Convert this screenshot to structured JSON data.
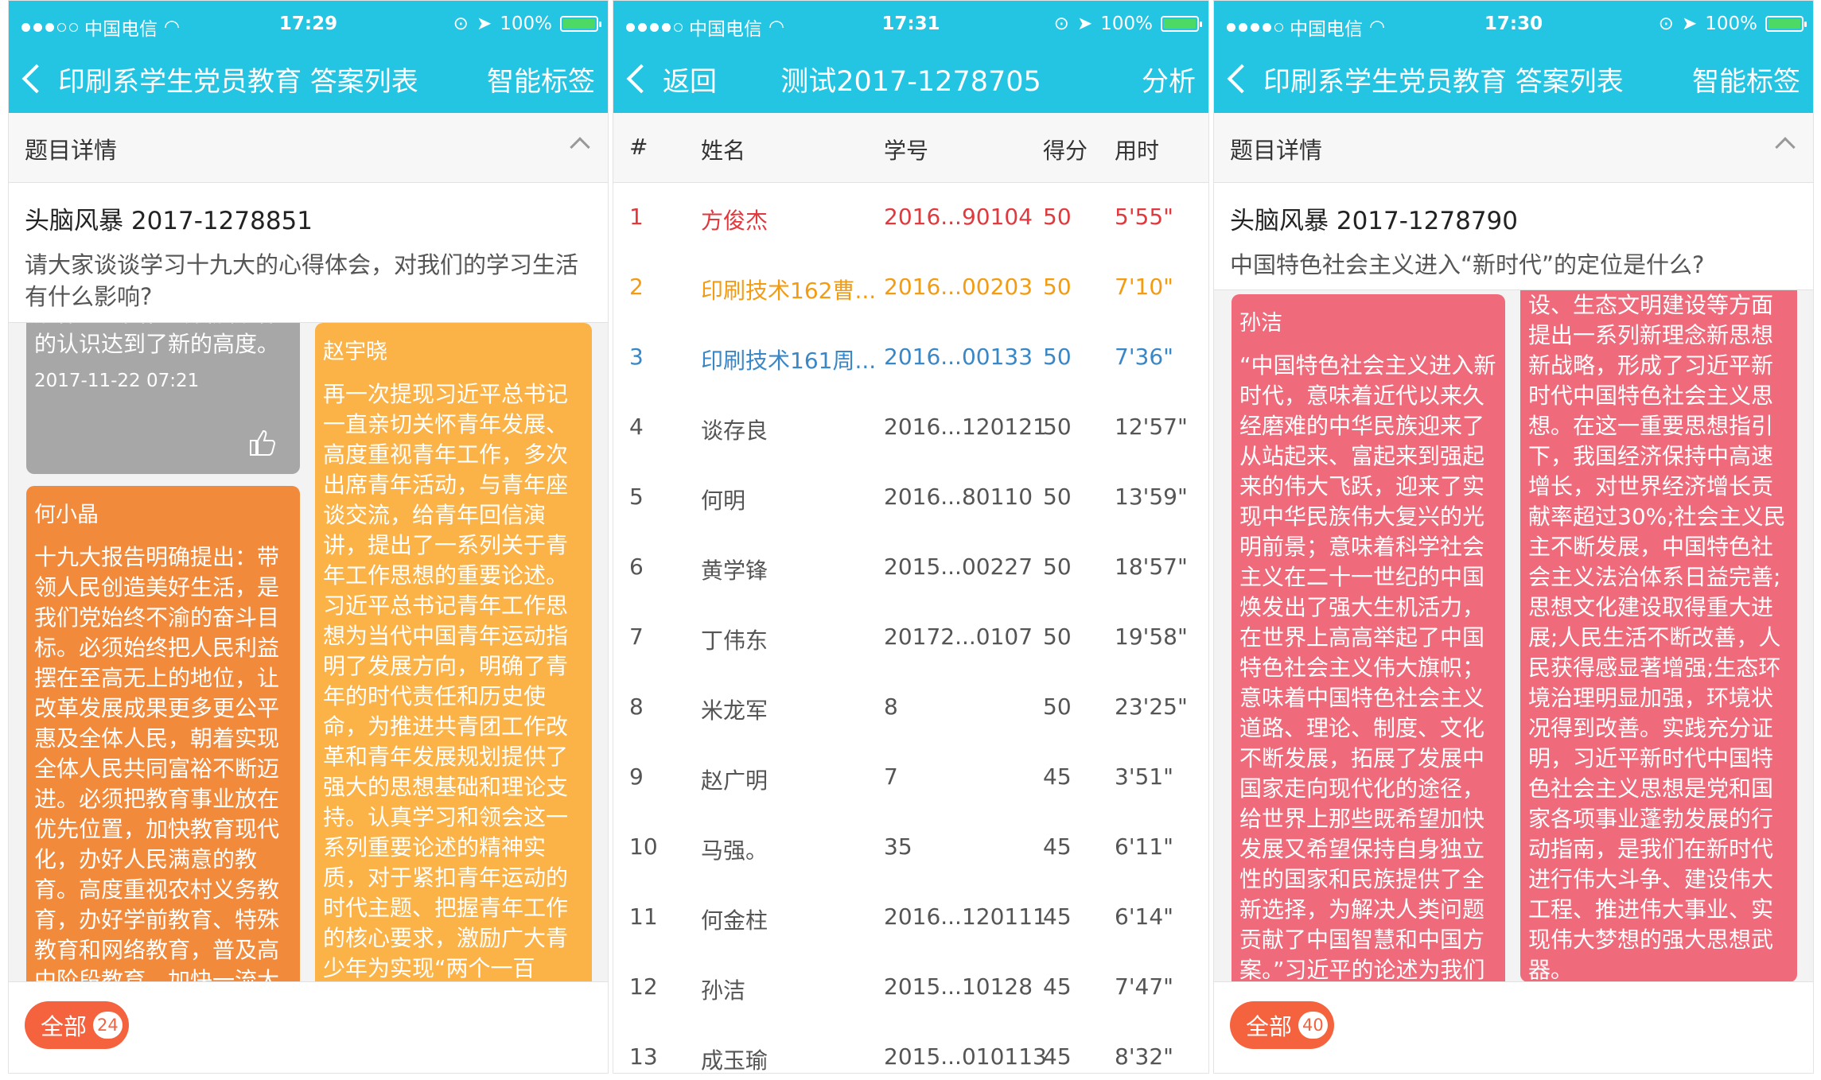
{
  "status": {
    "carrier": "中国电信",
    "battery": "100%"
  },
  "screen1": {
    "time": "17:29",
    "back_label": "印刷系学生党员教育 答案列表",
    "right_action": "智能标签",
    "section_label": "题目详情",
    "question_title": "头脑风暴 2017-1278851",
    "question_text": "请大家谈谈学习十九大的心得体会，对我们的学习生活有什么影响?",
    "cards": [
      {
        "text": "规律、人类社会发展规律的认识达到了新的高度。",
        "date": "2017-11-22 07:21"
      },
      {
        "name": "何小晶",
        "text": "十九大报告明确提出：带领人民创造美好生活，是我们党始终不渝的奋斗目标。必须始终把人民利益摆在至高无上的地位，让改革发展成果更多更公平惠及全体人民，朝着实现全体人民共同富裕不断迈进。必须把教育事业放在优先位置，加快教育现代化，办好人民满意的教育。高度重视农村义务教育，办好学前教育、特殊教育和网络教育，普及高中阶段教育，加快一流大"
      },
      {
        "name": "赵宇晓",
        "text": "再一次提现习近平总书记一直亲切关怀青年发展、高度重视青年工作，多次出席青年活动，与青年座谈交流，给青年回信演讲，提出了一系列关于青年工作思想的重要论述。习近平总书记青年工作思想为当代中国青年运动指明了发展方向，明确了青年的时代责任和历史使命，为推进共青团工作改革和青年发展规划提供了强大的思想基础和理论支持。认真学习和领会这一系列重要论述的精神实质，对于紧扣青年运动的时代主题、把握青年工作的核心要求，激励广大青少年为实现“两个一百"
      }
    ],
    "all_label": "全部",
    "all_count": "24"
  },
  "screen2": {
    "time": "17:31",
    "back_label": "返回",
    "title": "测试2017-1278705",
    "right_action": "分析",
    "columns": [
      "#",
      "姓名",
      "学号",
      "得分",
      "用时"
    ],
    "rows": [
      {
        "num": "1",
        "name": "方俊杰",
        "id": "2016...90104",
        "score": "50",
        "time": "5'55\"",
        "color": "#e0393e"
      },
      {
        "num": "2",
        "name": "印刷技术162曹...",
        "id": "2016...00203",
        "score": "50",
        "time": "7'10\"",
        "color": "#f39c12"
      },
      {
        "num": "3",
        "name": "印刷技术161周...",
        "id": "2016...00133",
        "score": "50",
        "time": "7'36\"",
        "color": "#3a87c8"
      },
      {
        "num": "4",
        "name": "谈存良",
        "id": "2016...120121",
        "score": "50",
        "time": "12'57\""
      },
      {
        "num": "5",
        "name": "何明",
        "id": "2016...80110",
        "score": "50",
        "time": "13'59\""
      },
      {
        "num": "6",
        "name": "黄学锋",
        "id": "2015...00227",
        "score": "50",
        "time": "18'57\""
      },
      {
        "num": "7",
        "name": "丁伟东",
        "id": "20172...0107",
        "score": "50",
        "time": "19'58\""
      },
      {
        "num": "8",
        "name": "米龙军",
        "id": "8",
        "score": "50",
        "time": "23'25\""
      },
      {
        "num": "9",
        "name": "赵广明",
        "id": "7",
        "score": "45",
        "time": "3'51\""
      },
      {
        "num": "10",
        "name": "马强。",
        "id": "35",
        "score": "45",
        "time": "6'11\""
      },
      {
        "num": "11",
        "name": "何金柱",
        "id": "2016...120111",
        "score": "45",
        "time": "6'14\""
      },
      {
        "num": "12",
        "name": "孙洁",
        "id": "2015...10128",
        "score": "45",
        "time": "7'47\""
      },
      {
        "num": "13",
        "name": "成玉瑜",
        "id": "2015...010113",
        "score": "45",
        "time": "8'32\""
      }
    ]
  },
  "screen3": {
    "time": "17:30",
    "back_label": "印刷系学生党员教育 答案列表",
    "right_action": "智能标签",
    "section_label": "题目详情",
    "question_title": "头脑风暴 2017-1278790",
    "question_text": "中国特色社会主义进入“新时代”的定位是什么?",
    "cards": [
      {
        "name": "孙洁",
        "text": "“中国特色社会主义进入新时代，意味着近代以来久经磨难的中华民族迎来了从站起来、富起来到强起来的伟大飞跃，迎来了实现中华民族伟大复兴的光明前景；意味着科学社会主义在二十一世纪的中国焕发出了强大生机活力，在世界上高高举起了中国特色社会主义伟大旗帜；意味着中国特色社会主义道路、理论、制度、文化不断发展，拓展了发展中国家走向现代化的途径，给世界上那些既希望加快发展又希望保持自身独立性的国家和民族提供了全新选择，为解决人类问题贡献了中国智慧和中国方案。”习近平的论述为我们"
      },
      {
        "text": "设、生态文明建设等方面提出一系列新理念新思想新战略，形成了习近平新时代中国特色社会主义思想。在这一重要思想指引下，我国经济保持中高速增长，对世界经济增长贡献率超过30%;社会主义民主不断发展，中国特色社会主义法治体系日益完善;思想文化建设取得重大进展;人民生活不断改善，人民获得感显著增强;生态环境治理明显加强，环境状况得到改善。实践充分证明，习近平新时代中国特色社会主义思想是党和国家各项事业蓬勃发展的行动指南，是我们在新时代进行伟大斗争、建设伟大工程、推进伟大事业、实现伟大梦想的强大思想武器。"
      }
    ],
    "all_label": "全部",
    "all_count": "40"
  },
  "colors": {
    "nav": "#24c4e3",
    "card_gray": "#a7a7a7",
    "card_orange_dark": "#f28a3c",
    "card_orange_light": "#fbb347",
    "card_pink": "#ef6a7a",
    "accent": "#f5623e"
  }
}
